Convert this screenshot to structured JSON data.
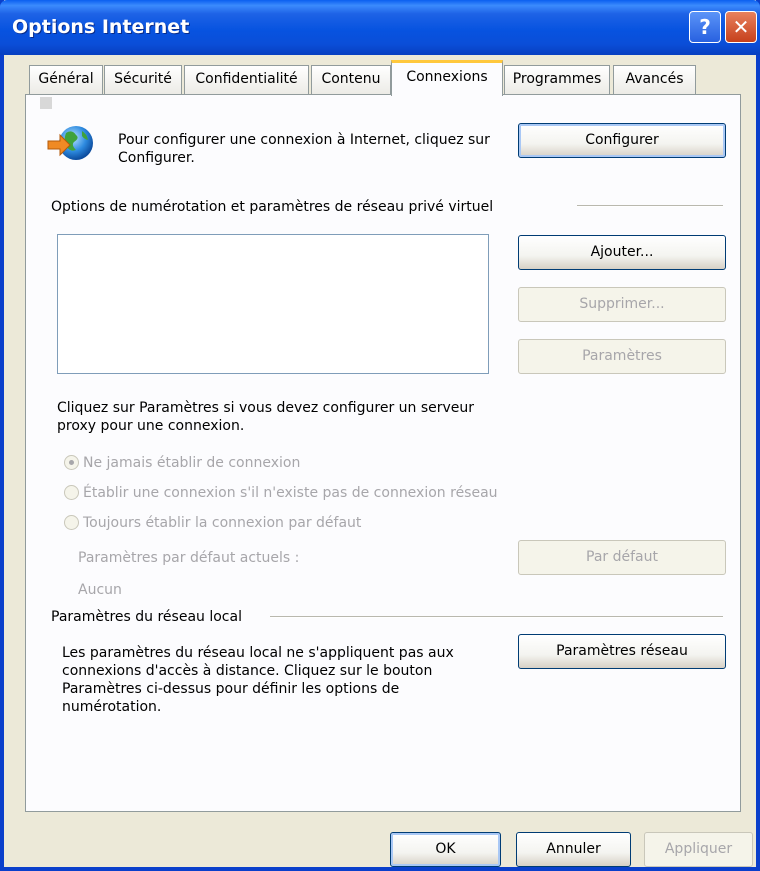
{
  "window": {
    "title": "Options Internet"
  },
  "tabs": [
    {
      "label": "Général"
    },
    {
      "label": "Sécurité"
    },
    {
      "label": "Confidentialité"
    },
    {
      "label": "Contenu"
    },
    {
      "label": "Connexions",
      "active": true
    },
    {
      "label": "Programmes"
    },
    {
      "label": "Avancés"
    }
  ],
  "setup": {
    "text": "Pour configurer une connexion à Internet, cliquez sur Configurer.",
    "button": "Configurer"
  },
  "dialup": {
    "heading": "Options de numérotation et paramètres de réseau privé virtuel",
    "add_button": "Ajouter...",
    "remove_button": "Supprimer...",
    "settings_button": "Paramètres",
    "proxy_text": "Cliquez sur Paramètres si vous devez configurer un serveur proxy pour une connexion.",
    "radio_never": "Ne jamais établir de connexion",
    "radio_when_none": "Établir une connexion s'il n'existe pas de connexion réseau",
    "radio_always": "Toujours établir la connexion par défaut",
    "current_default_label": "Paramètres par défaut actuels :",
    "current_default_value": "Aucun",
    "default_button": "Par défaut"
  },
  "lan": {
    "heading": "Paramètres du réseau local",
    "text": "Les paramètres du réseau local ne s'appliquent pas aux connexions d'accès à distance. Cliquez sur le bouton Paramètres ci-dessus pour définir les options de numérotation.",
    "button": "Paramètres réseau"
  },
  "footer": {
    "ok": "OK",
    "cancel": "Annuler",
    "apply": "Appliquer"
  },
  "colors": {
    "title_bar": "#0A54E4",
    "active_tab_highlight": "#FFC83C",
    "dialog_bg": "#ECE9D8",
    "disabled_text": "#A7A6AA"
  }
}
